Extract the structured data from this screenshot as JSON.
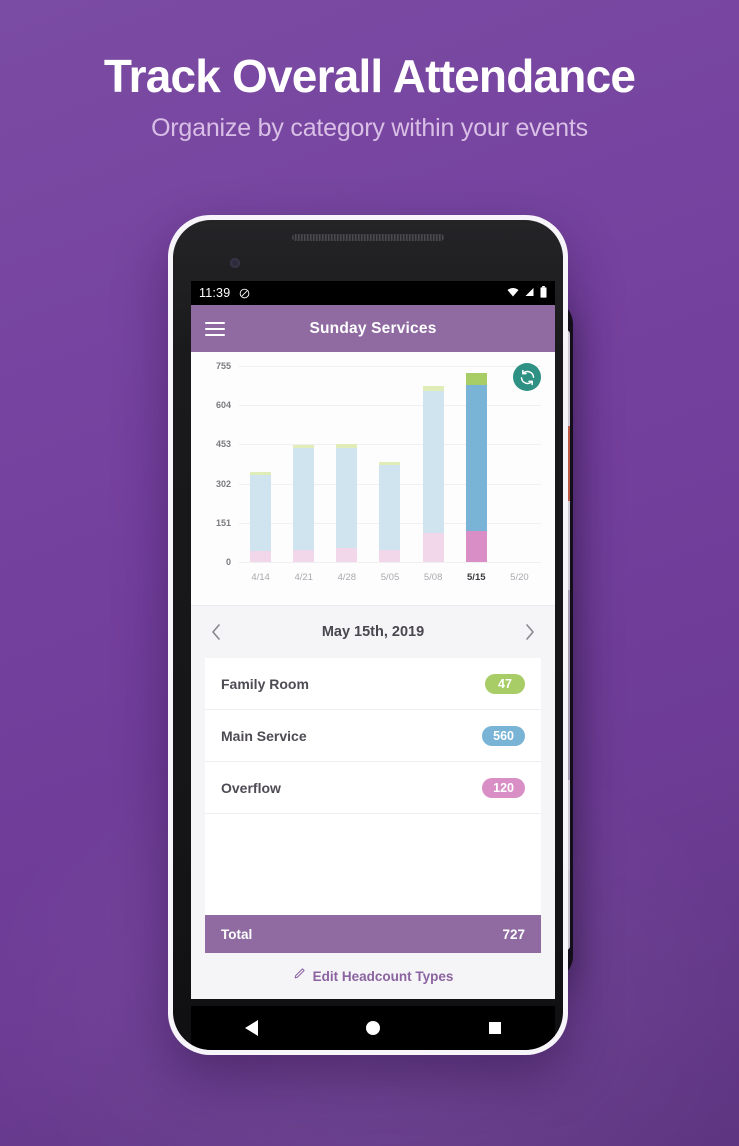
{
  "hero": {
    "title": "Track Overall Attendance",
    "subtitle": "Organize by category within your events"
  },
  "status_bar": {
    "time": "11:39",
    "dnd_icon": "do-not-disturb-icon",
    "wifi_icon": "wifi-icon",
    "signal_icon": "cellular-signal-icon",
    "battery_icon": "battery-icon"
  },
  "app_bar": {
    "menu_icon": "hamburger-menu-icon",
    "title": "Sunday Services",
    "background": "#8f6ba1"
  },
  "chart_panel": {
    "sync_icon": "refresh-sync-icon",
    "sync_color": "#2e9183"
  },
  "date_nav": {
    "prev_icon": "chevron-left-icon",
    "next_icon": "chevron-right-icon",
    "date": "May 15th, 2019"
  },
  "list": {
    "items": [
      {
        "label": "Family Room",
        "value": "47",
        "color": "#a8cc66"
      },
      {
        "label": "Main Service",
        "value": "560",
        "color": "#79b4d6"
      },
      {
        "label": "Overflow",
        "value": "120",
        "color": "#d98fc6"
      }
    ],
    "total_label": "Total",
    "total_value": "727"
  },
  "footer": {
    "edit_icon": "pencil-edit-icon",
    "edit_label": "Edit Headcount Types",
    "accent": "#8a63a0"
  },
  "nav_bar": {
    "back_icon": "triangle-back-icon",
    "home_icon": "circle-home-icon",
    "recents_icon": "square-recents-icon"
  },
  "chart_data": {
    "type": "bar",
    "stacked": true,
    "title": "",
    "xlabel": "",
    "ylabel": "",
    "ylim": [
      0,
      755
    ],
    "grid": true,
    "legend": false,
    "yticks": [
      0,
      151,
      302,
      453,
      604,
      755
    ],
    "categories": [
      "4/14",
      "4/21",
      "4/28",
      "5/05",
      "5/08",
      "5/15",
      "5/20"
    ],
    "selected_category": "5/15",
    "series": [
      {
        "name": "Overflow",
        "color": "#d98fc6",
        "faded_color": "#f2d6ea",
        "values": [
          42,
          48,
          55,
          45,
          110,
          120,
          0
        ]
      },
      {
        "name": "Main Service",
        "color": "#79b4d6",
        "faded_color": "#cfe4ef",
        "values": [
          293,
          390,
          385,
          330,
          550,
          560,
          0
        ]
      },
      {
        "name": "Family Room",
        "color": "#a8cc66",
        "faded_color": "#e1edb9",
        "values": [
          12,
          12,
          14,
          12,
          18,
          47,
          0
        ]
      }
    ],
    "totals": [
      347,
      450,
      454,
      387,
      678,
      727,
      0
    ]
  }
}
